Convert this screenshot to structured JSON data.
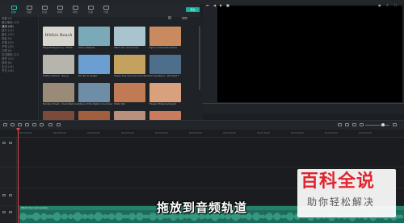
{
  "library_tabs": [
    {
      "label": "媒体",
      "icon": "media-icon",
      "active": true
    },
    {
      "label": "音频",
      "icon": "audio-icon",
      "active": false
    },
    {
      "label": "标题",
      "icon": "title-icon",
      "active": false
    },
    {
      "label": "转场",
      "icon": "transition-icon",
      "active": false
    },
    {
      "label": "特效",
      "icon": "effects-icon",
      "active": false
    },
    {
      "label": "元素",
      "icon": "elements-icon",
      "active": false
    },
    {
      "label": "分屏",
      "icon": "split-screen-icon",
      "active": false
    }
  ],
  "export_label": "导出",
  "categories": [
    {
      "label": "收藏 (3)",
      "active": false
    },
    {
      "label": "最近使用 (13)",
      "active": false
    },
    {
      "label": "通用 (48)",
      "active": true
    },
    {
      "label": "旅行 (12)",
      "active": false
    },
    {
      "label": "婚礼 (15)",
      "active": false
    },
    {
      "label": "电影 (9)",
      "active": false
    },
    {
      "label": "字幕 (20)",
      "active": false
    },
    {
      "label": "开场 (18)",
      "active": false
    },
    {
      "label": "片尾 (6)",
      "active": false
    },
    {
      "label": "社交媒体 (21)",
      "active": false
    },
    {
      "label": "商务 (10)",
      "active": false
    },
    {
      "label": "游戏 (8)",
      "active": false
    },
    {
      "label": "生活 (14)",
      "active": false
    },
    {
      "label": "节日 (16)",
      "active": false
    }
  ],
  "thumbnails": [
    {
      "label": "Elegant Beginning - Within",
      "thumb_text": "Within Reach",
      "color": "#d9d5cf"
    },
    {
      "label": "Sunny Palaces",
      "thumb_text": "",
      "color": "#7aa9b8"
    },
    {
      "label": "Warm Sun and Lonely",
      "thumb_text": "",
      "color": "#a9c4cf"
    },
    {
      "label": "Eye's Comments's Piano",
      "thumb_text": "",
      "color": "#c98a5f"
    },
    {
      "label": "Pretty In Brook - Being",
      "thumb_text": "",
      "color": "#b7b3ad"
    },
    {
      "label": "Fan B's to splash",
      "thumb_text": "",
      "color": "#6b9fd1"
    },
    {
      "label": "Happy Day Slow Summer Break",
      "thumb_text": "",
      "color": "#c4a15e"
    },
    {
      "label": "Loving Palace - Midnight T",
      "thumb_text": "",
      "color": "#4d6f8c"
    },
    {
      "label": "Familiar Street - Clout Memories",
      "thumb_text": "",
      "color": "#9a8a78"
    },
    {
      "label": "Share of the Ballet in Summer",
      "thumb_text": "",
      "color": "#6d8ea6"
    },
    {
      "label": "Pretty Tell",
      "thumb_text": "",
      "color": "#c07b54"
    },
    {
      "label": "Flower (Extended beat)",
      "thumb_text": "",
      "color": "#d8a07c"
    },
    {
      "label": "",
      "thumb_text": "",
      "color": "#7c4a3a"
    },
    {
      "label": "",
      "thumb_text": "",
      "color": "#a15f3e"
    },
    {
      "label": "",
      "thumb_text": "",
      "color": "#b9907c"
    },
    {
      "label": "",
      "thumb_text": "",
      "color": "#c97c5d"
    }
  ],
  "ruler_ticks": [
    "00:00:00:00",
    "00:00:05:00",
    "00:00:10:00",
    "00:00:15:00",
    "00:00:20:00",
    "00:00:25:00",
    "00:00:30:00",
    "00:00:35:00",
    "00:00:40:00",
    "00:00:45:00",
    "00:00:50:00"
  ],
  "audio_clip_label": "Warm Sun and Lonely",
  "caption": "拖放到音频轨道",
  "watermark": {
    "big": "百科全说",
    "small": "助你轻松解决"
  }
}
